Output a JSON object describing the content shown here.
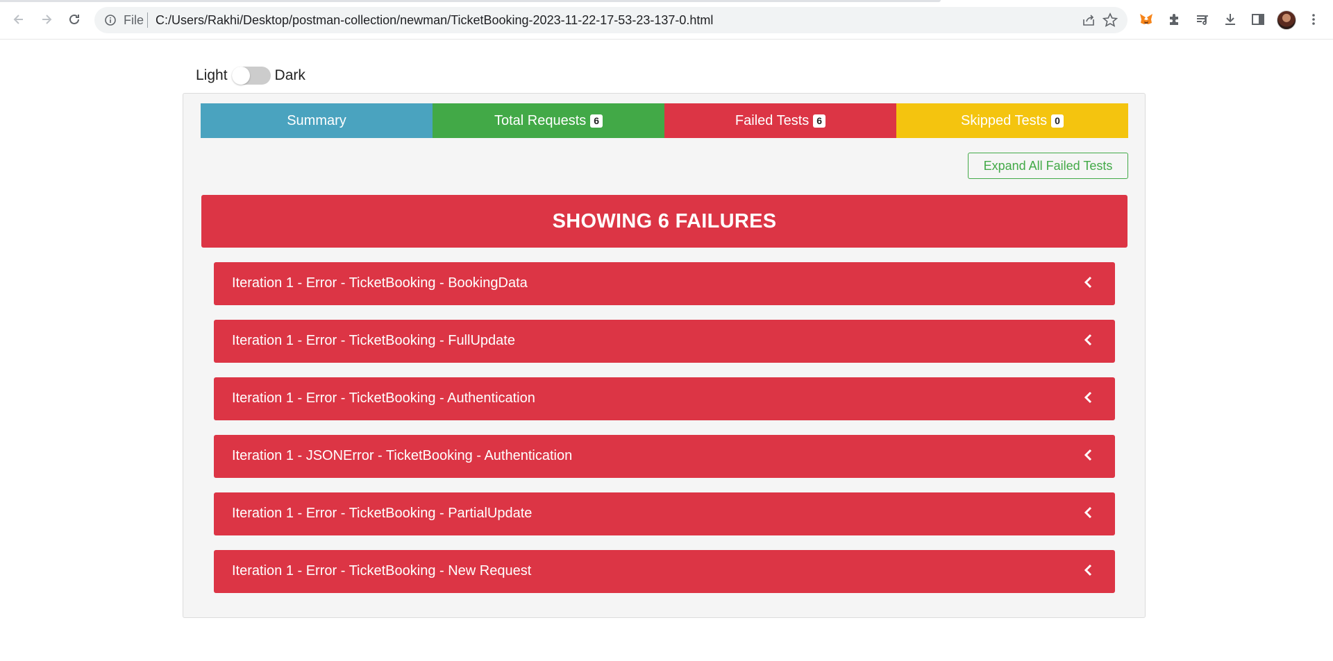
{
  "browser": {
    "file_label": "File",
    "url": "C:/Users/Rakhi/Desktop/postman-collection/newman/TicketBooking-2023-11-22-17-53-23-137-0.html"
  },
  "theme_toggle": {
    "light_label": "Light",
    "dark_label": "Dark"
  },
  "tabs": [
    {
      "label": "Summary",
      "badge": ""
    },
    {
      "label": "Total Requests",
      "badge": "6"
    },
    {
      "label": "Failed Tests",
      "badge": "6"
    },
    {
      "label": "Skipped Tests",
      "badge": "0"
    }
  ],
  "expand_button_label": "Expand All Failed Tests",
  "banner_title": "SHOWING 6 FAILURES",
  "failures": [
    {
      "label": "Iteration 1 - Error - TicketBooking - BookingData"
    },
    {
      "label": "Iteration 1 - Error - TicketBooking - FullUpdate"
    },
    {
      "label": "Iteration 1 - Error - TicketBooking - Authentication"
    },
    {
      "label": "Iteration 1 - JSONError - TicketBooking - Authentication"
    },
    {
      "label": "Iteration 1 - Error - TicketBooking - PartialUpdate"
    },
    {
      "label": "Iteration 1 - Error - TicketBooking - New Request"
    }
  ],
  "colors": {
    "summary": "#4aa3bf",
    "requests": "#42a947",
    "failed": "#dc3545",
    "skipped": "#f4c40f"
  }
}
